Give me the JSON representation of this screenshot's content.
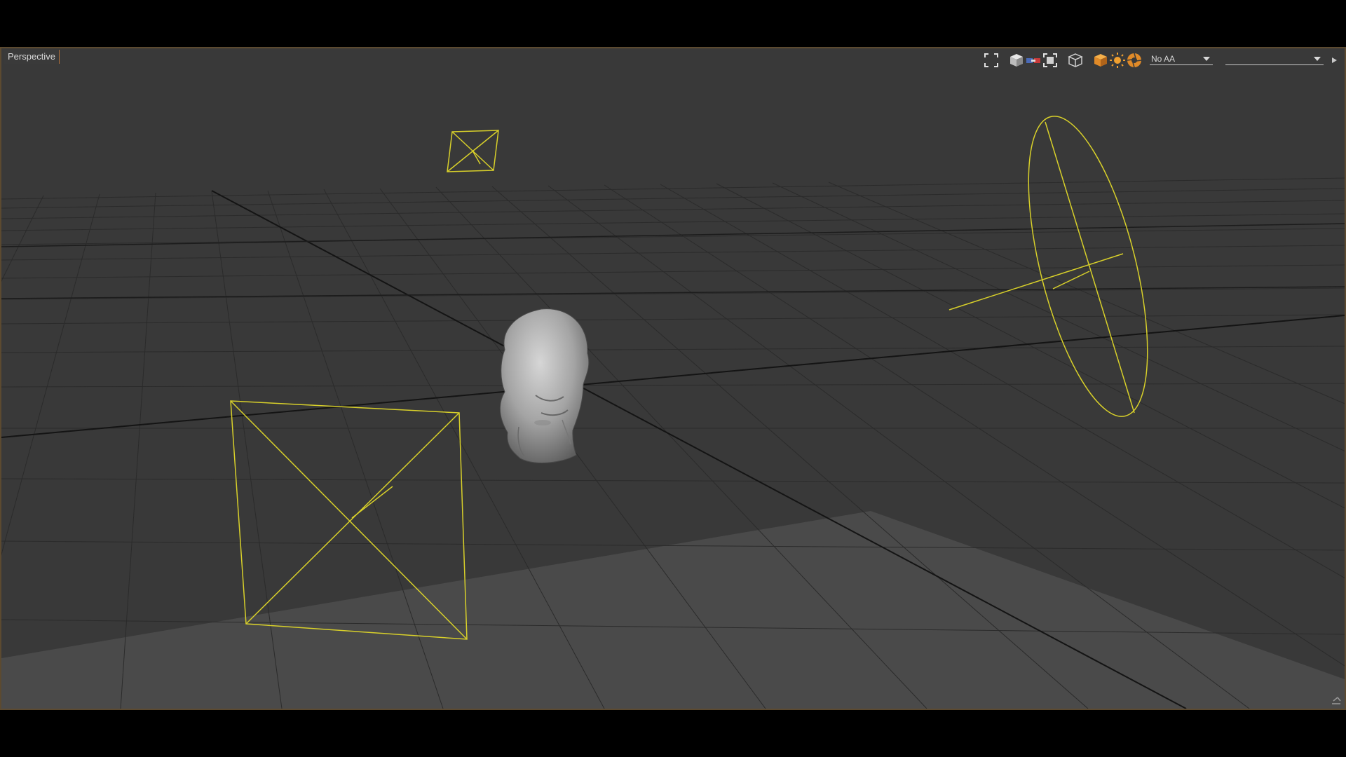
{
  "viewport": {
    "view_name": "Perspective"
  },
  "toolbar": {
    "antialias": {
      "selected": "No AA"
    },
    "second_dropdown": {
      "selected": ""
    },
    "icons": [
      "fullscreen-icon",
      "solid-cube-icon",
      "camera-link-icon",
      "frame-icon",
      "wireframe-cube-icon",
      "shaded-cube-icon",
      "sun-icon",
      "aperture-icon",
      "expand-arrow-icon",
      "resize-grip-icon"
    ]
  },
  "scene": {
    "objects": [
      "grid-floor",
      "head-model",
      "camera-near",
      "camera-far",
      "spotlight"
    ],
    "colors": {
      "background": "#393939",
      "grid": "#2c2c2c",
      "wireframe": "#d8d02a",
      "accent": "#e08a28"
    }
  }
}
